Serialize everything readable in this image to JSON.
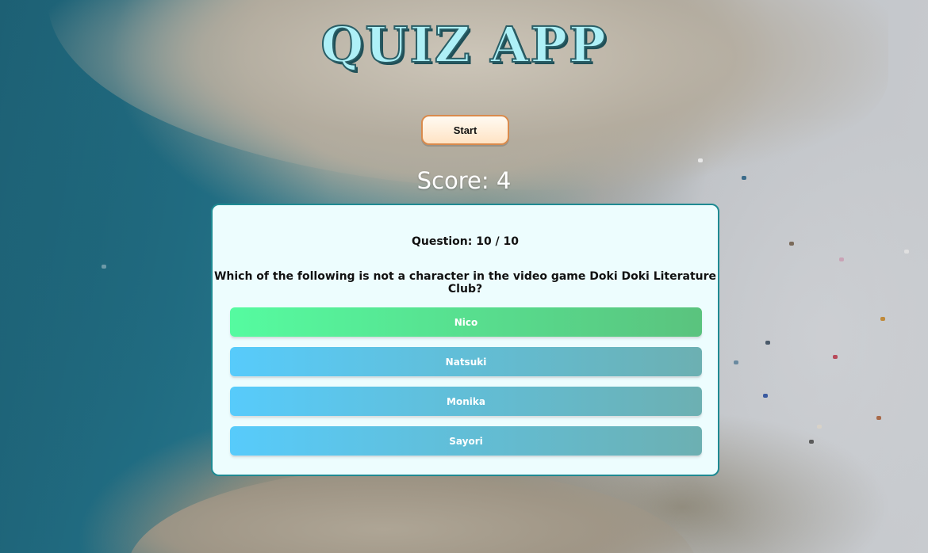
{
  "app": {
    "title": "QUIZ APP"
  },
  "controls": {
    "start_label": "Start"
  },
  "score": {
    "text": "Score: 4"
  },
  "quiz": {
    "counter": "Question: 10 / 10",
    "question": "Which of the following is not a character in the video game Doki Doki Literature Club?",
    "answers": [
      {
        "label": "Nico",
        "state": "correct"
      },
      {
        "label": "Natsuki",
        "state": "default"
      },
      {
        "label": "Monika",
        "state": "default"
      },
      {
        "label": "Sayori",
        "state": "default"
      }
    ]
  },
  "colors": {
    "card_border": "#1f8a92",
    "card_bg": "#edfdfe",
    "correct_start": "#55fba0",
    "correct_end": "#5ac37e",
    "default_start": "#57cbfb",
    "default_end": "#6cb0b2",
    "title_fill": "#aef0f7",
    "start_border": "#d98a4c"
  }
}
